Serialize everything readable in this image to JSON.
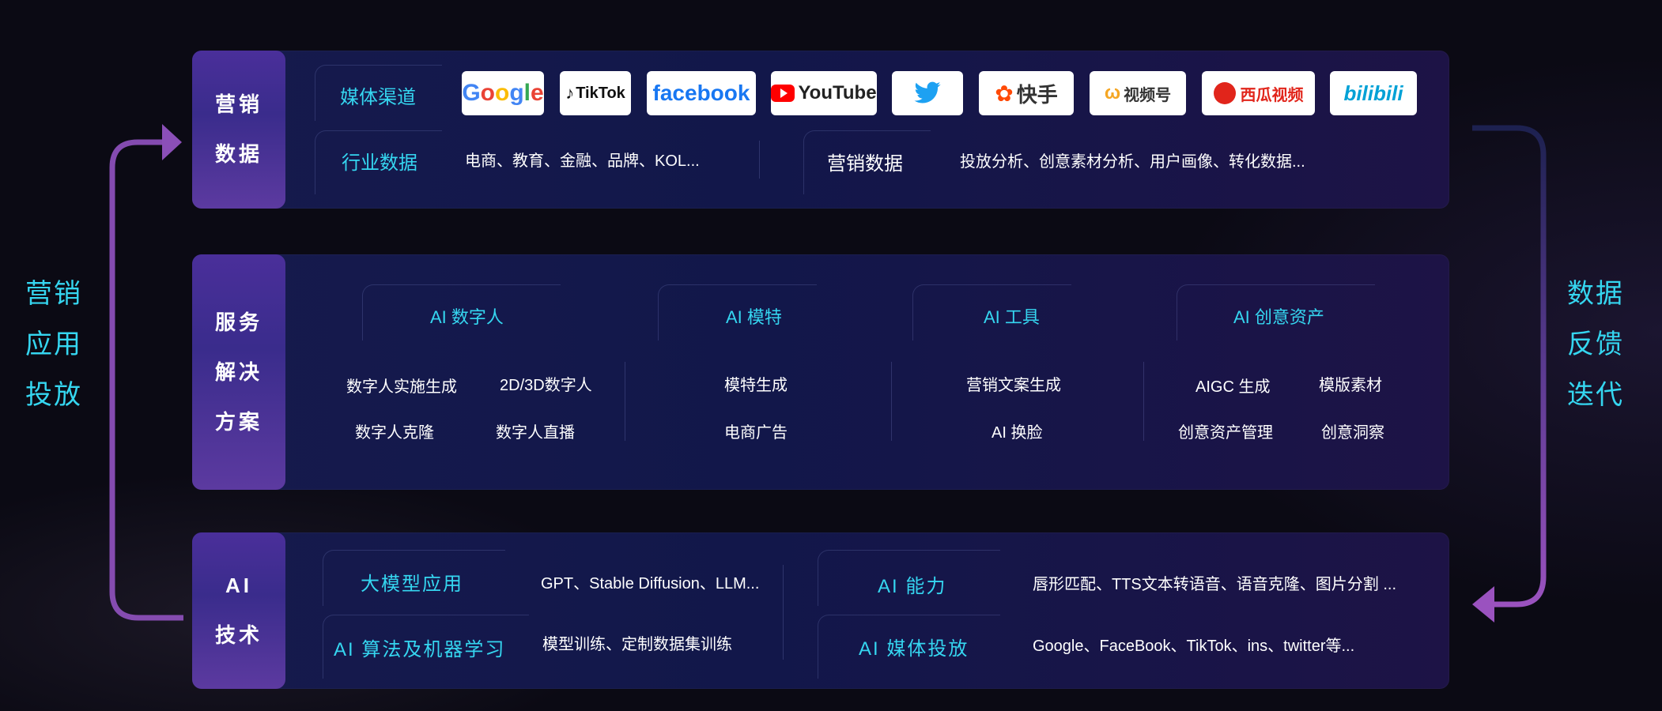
{
  "left_loop": [
    "营销",
    "应用",
    "投放"
  ],
  "right_loop": [
    "数据",
    "反馈",
    "迭代"
  ],
  "row1": {
    "side": [
      "营销",
      "数据"
    ],
    "media_label": "媒体渠道",
    "logos": {
      "google": "Google",
      "tiktok": "TikTok",
      "facebook": "facebook",
      "youtube": "YouTube",
      "twitter": "twitter",
      "kuaishou": "快手",
      "shipinhao": "视频号",
      "xigua": "西瓜视频",
      "bilibili": "bilibili"
    },
    "industry_label": "行业数据",
    "industry_text": "电商、教育、金融、品牌、KOL...",
    "marketing_label": "营销数据",
    "marketing_text": "投放分析、创意素材分析、用户画像、转化数据..."
  },
  "row2": {
    "side": [
      "服务",
      "解决",
      "方案"
    ],
    "col1": {
      "title": "AI 数字人",
      "items": [
        "数字人实施生成",
        "2D/3D数字人",
        "数字人克隆",
        "数字人直播"
      ]
    },
    "col2": {
      "title": "AI 模特",
      "items": [
        "模特生成",
        "电商广告"
      ]
    },
    "col3": {
      "title": "AI 工具",
      "items": [
        "营销文案生成",
        "AI 换脸"
      ]
    },
    "col4": {
      "title": "AI 创意资产",
      "items": [
        "AIGC 生成",
        "模版素材",
        "创意资产管理",
        "创意洞察"
      ]
    }
  },
  "row3": {
    "side": [
      "AI",
      "技术"
    ],
    "llm_label": "大模型应用",
    "llm_text": "GPT、Stable Diffusion、LLM...",
    "ml_label": "AI 算法及机器学习",
    "ml_text": "模型训练、定制数据集训练",
    "ability_label": "AI 能力",
    "ability_text": "唇形匹配、TTS文本转语音、语音克隆、图片分割 ...",
    "media_label": "AI 媒体投放",
    "media_text": "Google、FaceBook、TikTok、ins、twitter等..."
  },
  "colors": {
    "accent": "#35d6f0",
    "arrow": "#8b4fb8"
  }
}
